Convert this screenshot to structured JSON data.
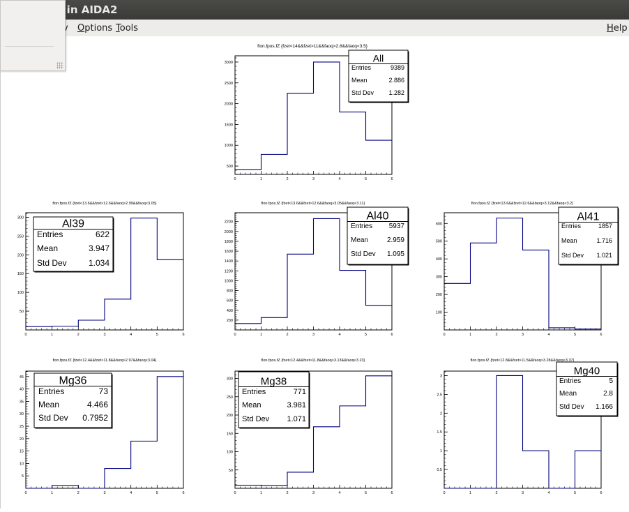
{
  "window": {
    "title_visible": "D in AIDA2"
  },
  "menu": {
    "items": [
      {
        "label": "v"
      },
      {
        "label": "Options",
        "accel": "O",
        "rest": "ptions"
      },
      {
        "label": "Tools",
        "accel": "T",
        "rest": "ools"
      }
    ],
    "help": {
      "label": "Help",
      "accel": "H",
      "rest": "elp"
    }
  },
  "colors": {
    "line": "#000080",
    "axis": "#000000"
  },
  "chart_data": [
    {
      "type": "histogram",
      "title": "flon.fpos.fZ {fzet<14&&fzet>11&&faoq>2.8&&faoq<3.5}",
      "stats": {
        "name": "All",
        "entries": "9389",
        "mean": "2.886",
        "std_dev": "1.282"
      },
      "bin_edges": [
        0,
        1,
        2,
        3,
        4,
        5,
        6
      ],
      "values": [
        410,
        780,
        2250,
        3000,
        1800,
        1120
      ],
      "xlim": [
        0,
        6
      ],
      "ylim": [
        300,
        3150
      ],
      "xticks": [
        "0",
        "1",
        "2",
        "3",
        "4",
        "5",
        "6"
      ],
      "yticks": [
        500,
        1000,
        1500,
        2000,
        2500,
        3000
      ]
    },
    {
      "type": "histogram",
      "title": "flon.fpos.fZ {fzet<13.6&&fzet>12.6&&faoq>2.99&&faoq<3.05}",
      "stats": {
        "name": "Al39",
        "entries": "622",
        "mean": "3.947",
        "std_dev": "1.034"
      },
      "bin_edges": [
        0,
        1,
        2,
        3,
        4,
        5,
        6
      ],
      "values": [
        9,
        10,
        26,
        82,
        298,
        187
      ],
      "xlim": [
        0,
        6
      ],
      "ylim": [
        0,
        312
      ],
      "xticks": [
        "0",
        "1",
        "2",
        "3",
        "4",
        "5",
        "6"
      ],
      "yticks": [
        50,
        100,
        150,
        200,
        250,
        300
      ]
    },
    {
      "type": "histogram",
      "title": "flon.fpos.fZ {fzet<13.6&&fzet>12.6&&faoq>3.05&&faoq<3.11}",
      "stats": {
        "name": "Al40",
        "entries": "5937",
        "mean": "2.959",
        "std_dev": "1.095"
      },
      "bin_edges": [
        0,
        1,
        2,
        3,
        4,
        5,
        6
      ],
      "values": [
        130,
        250,
        1540,
        2260,
        1210,
        500
      ],
      "xlim": [
        0,
        6
      ],
      "ylim": [
        0,
        2380
      ],
      "xticks": [
        "0",
        "1",
        "2",
        "3",
        "4",
        "5",
        "6"
      ],
      "yticks": [
        200,
        400,
        600,
        800,
        1000,
        1200,
        1400,
        1600,
        1800,
        2000,
        2200
      ]
    },
    {
      "type": "histogram",
      "title": "flon.fpos.fZ {fzet<13.6&&fzet>12.6&&faoq>3.12&&faoq<3.2}",
      "stats": {
        "name": "Al41",
        "entries": "1857",
        "mean": "1.716",
        "std_dev": "1.021"
      },
      "bin_edges": [
        0,
        1,
        2,
        3,
        4,
        5,
        6
      ],
      "values": [
        262,
        490,
        630,
        450,
        12,
        5
      ],
      "xlim": [
        0,
        6
      ],
      "ylim": [
        0,
        660
      ],
      "xticks": [
        "0",
        "1",
        "2",
        "3",
        "4",
        "5",
        "6"
      ],
      "yticks": [
        100,
        200,
        300,
        400,
        500,
        600
      ]
    },
    {
      "type": "histogram",
      "title": "flon.fpos.fZ {fzet<12.4&&fzet>11.8&&faoq>2.97&&faoq<3.04}",
      "stats": {
        "name": "Mg36",
        "entries": "73",
        "mean": "4.466",
        "std_dev": "0.7952"
      },
      "bin_edges": [
        0,
        1,
        2,
        3,
        4,
        5,
        6
      ],
      "values": [
        0,
        1,
        0,
        8,
        19,
        45
      ],
      "xlim": [
        0,
        6
      ],
      "ylim": [
        0,
        47.2
      ],
      "xticks": [
        "0",
        "1",
        "2",
        "3",
        "4",
        "5",
        "6"
      ],
      "yticks": [
        5,
        10,
        15,
        20,
        25,
        30,
        35,
        40,
        45
      ]
    },
    {
      "type": "histogram",
      "title": "flon.fpos.fZ {fzet<12.4&&fzet>11.8&&faoq>3.13&&faoq<3.23}",
      "stats": {
        "name": "Mg38",
        "entries": "771",
        "mean": "3.981",
        "std_dev": "1.071"
      },
      "bin_edges": [
        0,
        1,
        2,
        3,
        4,
        5,
        6
      ],
      "values": [
        8,
        7,
        44,
        168,
        225,
        307
      ],
      "xlim": [
        0,
        6
      ],
      "ylim": [
        0,
        320
      ],
      "xticks": [
        "0",
        "1",
        "2",
        "3",
        "4",
        "5",
        "6"
      ],
      "yticks": [
        50,
        100,
        150,
        200,
        250,
        300
      ]
    },
    {
      "type": "histogram",
      "title": "flon.fpos.fZ {fzet<12.8&&fzet>11.5&&faoq>3.28&&faoq<3.37}",
      "stats": {
        "name": "Mg40",
        "entries": "5",
        "mean": "2.8",
        "std_dev": "1.166"
      },
      "bin_edges": [
        0,
        1,
        2,
        3,
        4,
        5,
        6
      ],
      "values": [
        0,
        0,
        3,
        1,
        0,
        1
      ],
      "xlim": [
        0,
        6
      ],
      "ylim": [
        0,
        3.12
      ],
      "xticks": [
        "0",
        "1",
        "2",
        "3",
        "4",
        "5",
        "6"
      ],
      "yticks": [
        0.5,
        1,
        1.5,
        2,
        2.5,
        3
      ]
    }
  ],
  "stat_labels": {
    "entries": "Entries",
    "mean": "Mean",
    "std_dev": "Std Dev"
  }
}
